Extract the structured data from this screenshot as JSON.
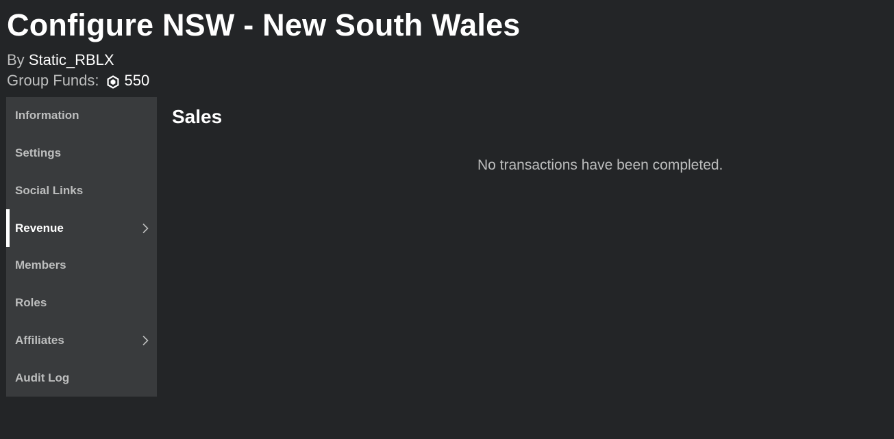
{
  "header": {
    "title": "Configure NSW - New South Wales",
    "by_label": "By",
    "owner": "Static_RBLX",
    "funds_label": "Group Funds:",
    "funds_icon": "robux-icon",
    "funds_amount": "550"
  },
  "sidebar": {
    "items": [
      {
        "label": "Information",
        "active": false,
        "has_submenu": false
      },
      {
        "label": "Settings",
        "active": false,
        "has_submenu": false
      },
      {
        "label": "Social Links",
        "active": false,
        "has_submenu": false
      },
      {
        "label": "Revenue",
        "active": true,
        "has_submenu": true
      },
      {
        "label": "Members",
        "active": false,
        "has_submenu": false
      },
      {
        "label": "Roles",
        "active": false,
        "has_submenu": false
      },
      {
        "label": "Affiliates",
        "active": false,
        "has_submenu": true
      },
      {
        "label": "Audit Log",
        "active": false,
        "has_submenu": false
      }
    ]
  },
  "main": {
    "section_title": "Sales",
    "empty_message": "No transactions have been completed."
  },
  "colors": {
    "background": "#232527",
    "sidebar": "#393b3d",
    "text_primary": "#ffffff",
    "text_secondary": "#bdbebe"
  }
}
